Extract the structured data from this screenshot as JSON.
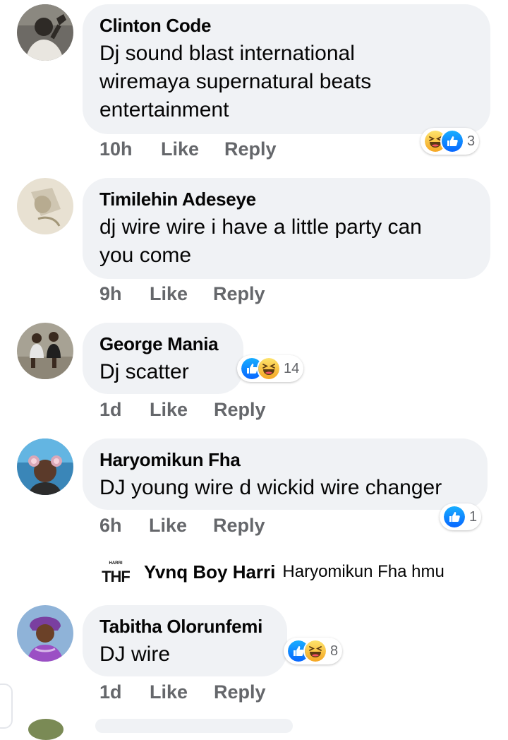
{
  "comments": [
    {
      "name": "Clinton Code",
      "text_lines": [
        "Dj sound blast  international",
        "wiremaya supernatural beats",
        "entertainment"
      ],
      "time": "10h",
      "like": "Like",
      "reply": "Reply",
      "reactions": {
        "icons": [
          "haha-icon",
          "like-icon"
        ],
        "count": "3"
      }
    },
    {
      "name": "Timilehin Adeseye",
      "text_lines": [
        "dj wire wire i have a little party can",
        "you come"
      ],
      "time": "9h",
      "like": "Like",
      "reply": "Reply"
    },
    {
      "name": "George Mania",
      "text_lines": [
        "Dj scatter"
      ],
      "time": "1d",
      "like": "Like",
      "reply": "Reply",
      "reactions": {
        "icons": [
          "like-icon",
          "haha-icon"
        ],
        "count": "14"
      }
    },
    {
      "name": "Haryomikun Fha",
      "text_lines": [
        "DJ young wire d wickid wire changer"
      ],
      "time": "6h",
      "like": "Like",
      "reply": "Reply",
      "reactions": {
        "icons": [
          "like-icon"
        ],
        "count": "1"
      },
      "replies": [
        {
          "name": "Yvnq Boy Harri",
          "text": "Haryomikun Fha hmu",
          "avatar_text": "THF"
        }
      ]
    },
    {
      "name": "Tabitha Olorunfemi",
      "text_lines": [
        "DJ wire"
      ],
      "time": "1d",
      "like": "Like",
      "reply": "Reply",
      "reactions": {
        "icons": [
          "like-icon",
          "haha-icon"
        ],
        "count": "8"
      }
    }
  ],
  "colors": {
    "bubble": "#f0f2f5",
    "meta_text": "#65676b",
    "like_blue": "#1877f2",
    "haha_yellow": "#f7b928"
  }
}
